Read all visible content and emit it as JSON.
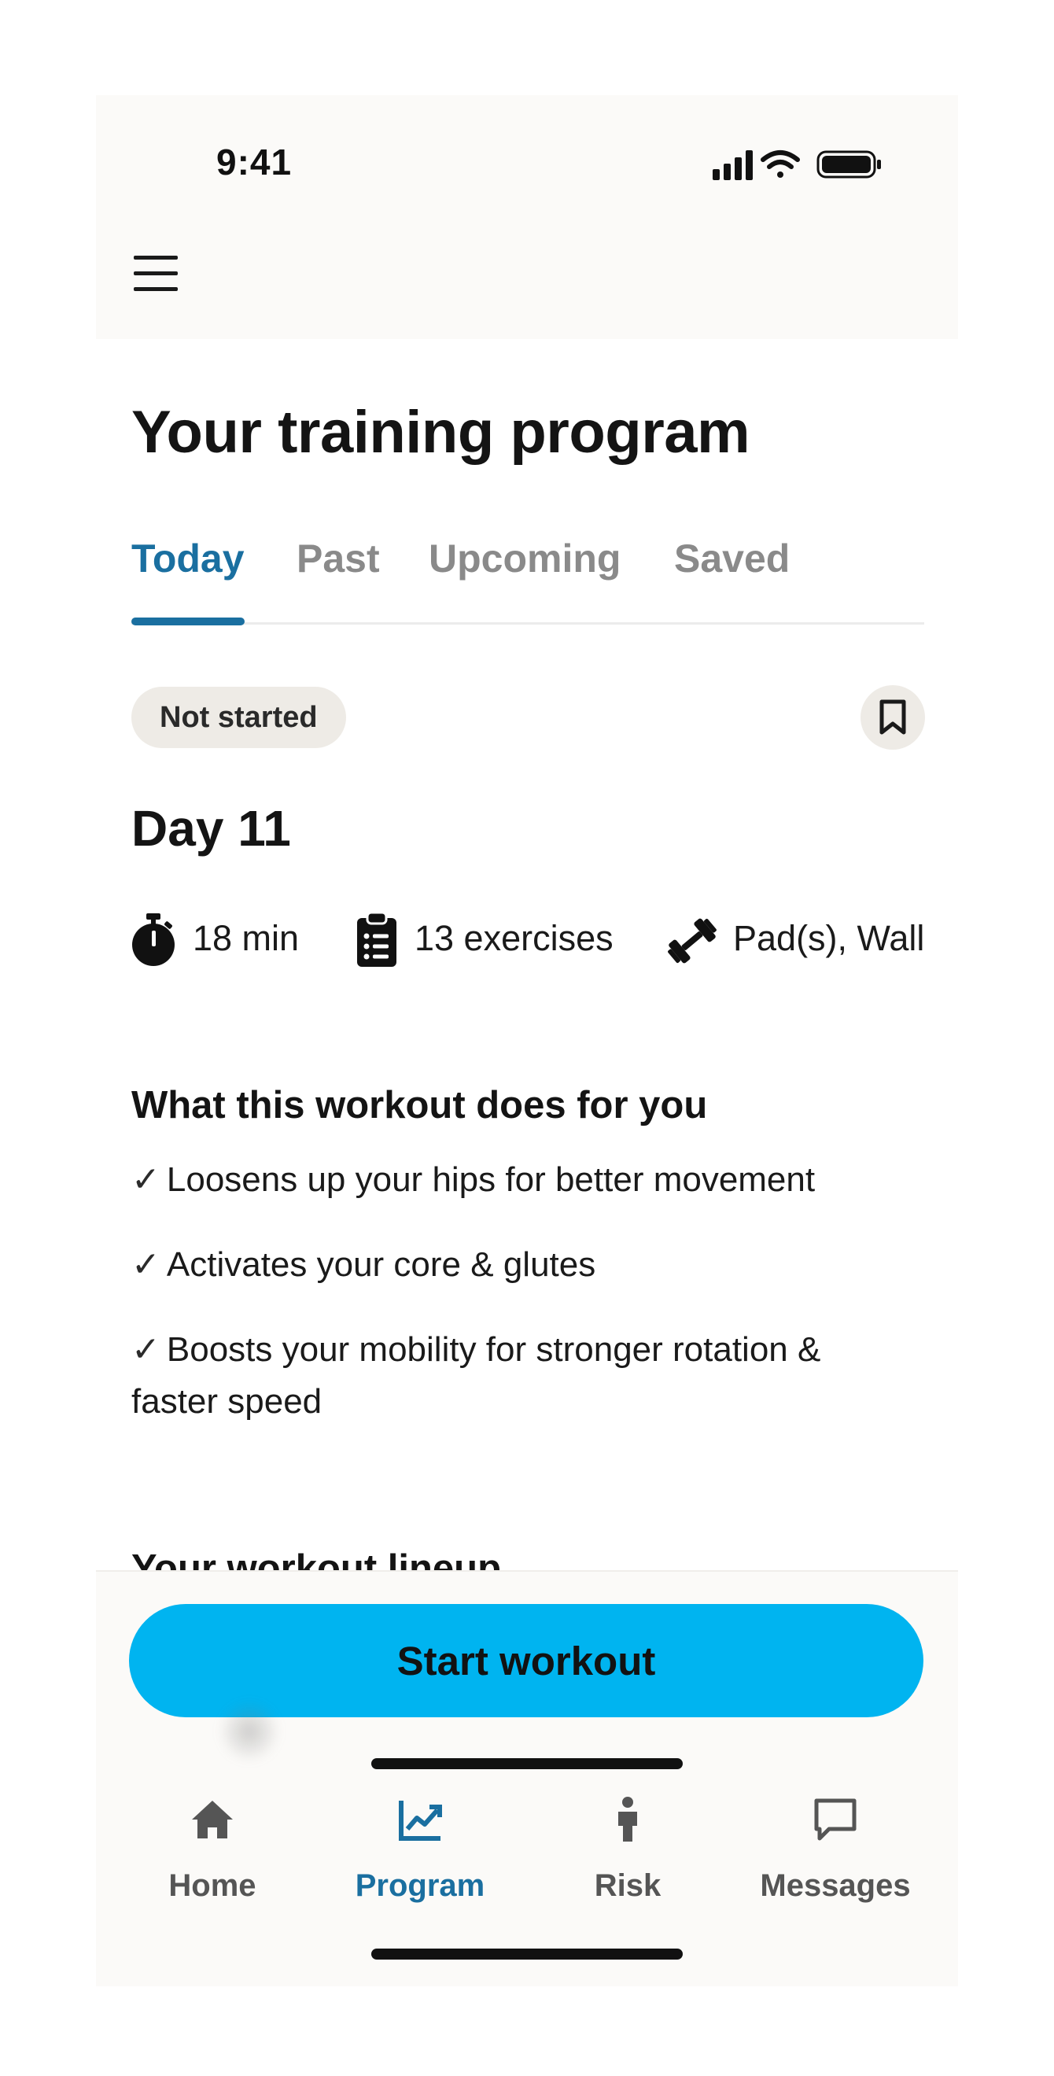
{
  "status_bar": {
    "time": "9:41"
  },
  "page": {
    "title": "Your training program"
  },
  "tabs": [
    {
      "label": "Today",
      "active": true
    },
    {
      "label": "Past",
      "active": false
    },
    {
      "label": "Upcoming",
      "active": false
    },
    {
      "label": "Saved",
      "active": false
    }
  ],
  "workout": {
    "status": "Not started",
    "day": "Day 11",
    "duration": "18 min",
    "exercises": "13 exercises",
    "equipment": "Pad(s), Wall"
  },
  "benefits": {
    "title": "What this workout does for you",
    "items": [
      "Loosens up your hips for better movement",
      "Activates your core & glutes",
      "Boosts your mobility for stronger rotation & faster speed"
    ]
  },
  "lineup": {
    "title": "Your workout lineup"
  },
  "actions": {
    "start_label": "Start workout"
  },
  "bottom_nav": [
    {
      "label": "Home",
      "icon": "home-icon",
      "active": false
    },
    {
      "label": "Program",
      "icon": "chart-icon",
      "active": true
    },
    {
      "label": "Risk",
      "icon": "person-icon",
      "active": false
    },
    {
      "label": "Messages",
      "icon": "message-icon",
      "active": false
    }
  ],
  "colors": {
    "accent": "#1a6fa0",
    "primary_button": "#00b4f0",
    "badge_bg": "#eeebe6"
  }
}
